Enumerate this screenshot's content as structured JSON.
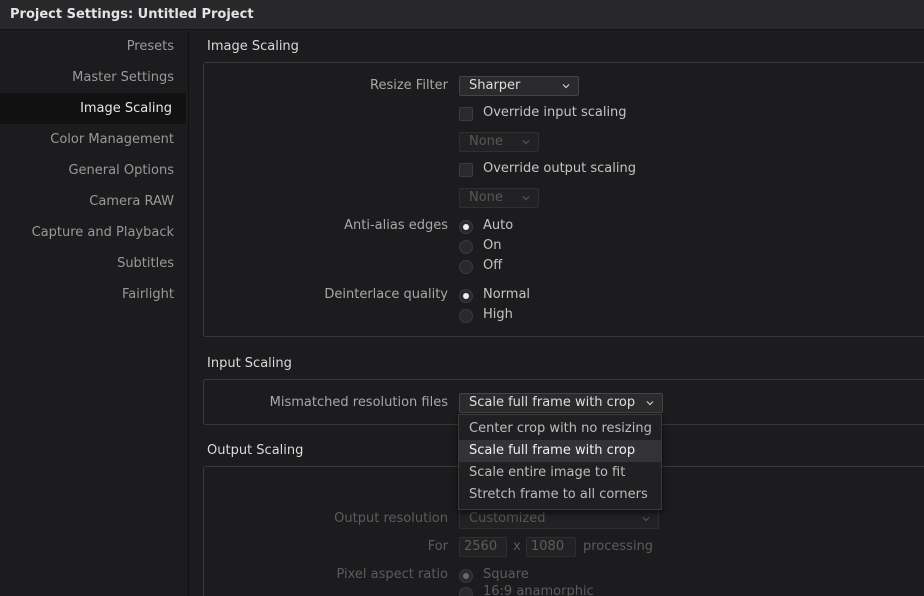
{
  "window": {
    "title": "Project Settings:  Untitled Project"
  },
  "sidebar": {
    "items": [
      {
        "label": "Presets"
      },
      {
        "label": "Master Settings"
      },
      {
        "label": "Image Scaling"
      },
      {
        "label": "Color Management"
      },
      {
        "label": "General Options"
      },
      {
        "label": "Camera RAW"
      },
      {
        "label": "Capture and Playback"
      },
      {
        "label": "Subtitles"
      },
      {
        "label": "Fairlight"
      }
    ],
    "active": "Image Scaling"
  },
  "image_scaling": {
    "title": "Image Scaling",
    "resize_filter": {
      "label": "Resize Filter",
      "value": "Sharper"
    },
    "override_input": {
      "label": "Override input scaling",
      "checked": false,
      "select": "None"
    },
    "override_output": {
      "label": "Override output scaling",
      "checked": false,
      "select": "None"
    },
    "anti_alias": {
      "label": "Anti-alias edges",
      "options": [
        "Auto",
        "On",
        "Off"
      ],
      "selected": "Auto"
    },
    "deinterlace": {
      "label": "Deinterlace quality",
      "options": [
        "Normal",
        "High"
      ],
      "selected": "Normal"
    }
  },
  "input_scaling": {
    "title": "Input Scaling",
    "mismatched": {
      "label": "Mismatched resolution files",
      "value": "Scale full frame with crop",
      "options": [
        "Center crop with no resizing",
        "Scale full frame with crop",
        "Scale entire image to fit",
        "Stretch frame to all corners"
      ]
    }
  },
  "output_scaling": {
    "title": "Output Scaling",
    "output_resolution": {
      "label": "Output resolution",
      "value": "Customized"
    },
    "for": {
      "label": "For",
      "width": "2560",
      "x": "x",
      "height": "1080",
      "suffix": "processing"
    },
    "pixel_aspect": {
      "label": "Pixel aspect ratio",
      "options": [
        "Square",
        "16:9 anamorphic"
      ],
      "selected": "Square"
    }
  }
}
